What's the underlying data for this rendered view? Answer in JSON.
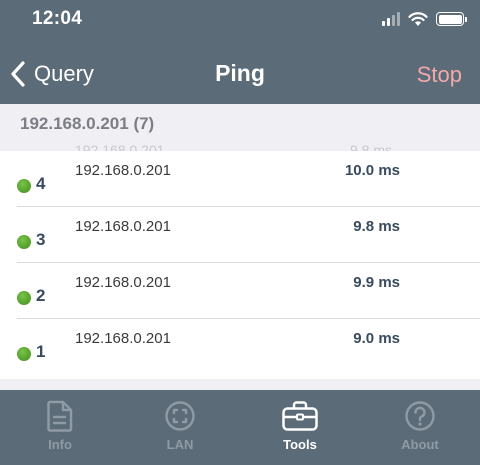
{
  "status": {
    "time": "12:04",
    "icons": [
      "cellular-signal-icon",
      "wifi-icon",
      "battery-icon"
    ]
  },
  "nav": {
    "back_label": "Query",
    "title": "Ping",
    "stop_label": "Stop"
  },
  "section": {
    "title": "192.168.0.201 (7)"
  },
  "ghost_row": {
    "ip": "192.168.0.201",
    "time": "9.8 ms"
  },
  "rows": [
    {
      "seq": "4",
      "ip": "192.168.0.201",
      "time": "10.0 ms"
    },
    {
      "seq": "3",
      "ip": "192.168.0.201",
      "time": "9.8 ms"
    },
    {
      "seq": "2",
      "ip": "192.168.0.201",
      "time": "9.9 ms"
    },
    {
      "seq": "1",
      "ip": "192.168.0.201",
      "time": "9.0 ms"
    }
  ],
  "tabs": [
    {
      "label": "Info",
      "icon": "document-icon",
      "active": false
    },
    {
      "label": "LAN",
      "icon": "lan-scan-icon",
      "active": false
    },
    {
      "label": "Tools",
      "icon": "toolbox-icon",
      "active": true
    },
    {
      "label": "About",
      "icon": "question-circle-icon",
      "active": false
    }
  ],
  "colors": {
    "header_bg": "#5b6b78",
    "stop": "#f3a9a9",
    "status_dot": "#5aa832",
    "accent_text": "#394b5e"
  }
}
